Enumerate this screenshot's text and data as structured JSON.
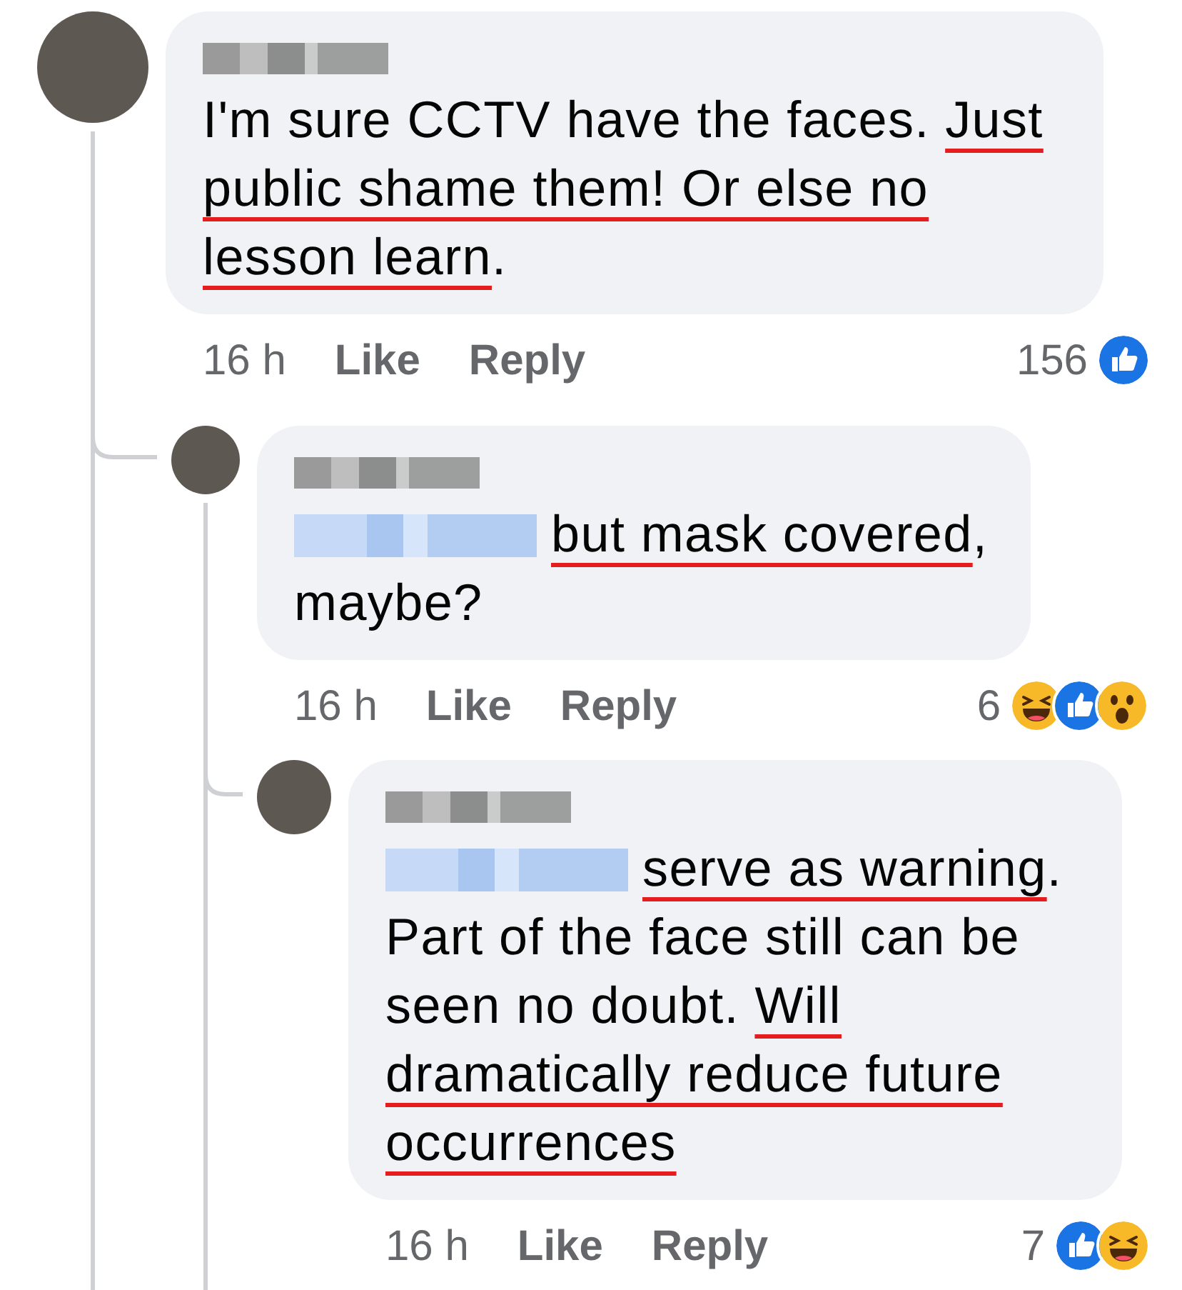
{
  "comments": [
    {
      "text": [
        {
          "kind": "plain",
          "text": "I'm sure CCTV have the faces. "
        },
        {
          "kind": "underlined",
          "text": "Just public shame them! Or else no lesson learn"
        },
        {
          "kind": "plain",
          "text": "."
        }
      ],
      "time": "16 h",
      "like_label": "Like",
      "reply_label": "Reply",
      "reaction_count": "156",
      "reactions": [
        {
          "kind": "like"
        }
      ],
      "children": [
        {
          "text": [
            {
              "kind": "mention"
            },
            {
              "kind": "underlined",
              "text": "but mask covered"
            },
            {
              "kind": "plain",
              "text": ", maybe?"
            }
          ],
          "time": "16 h",
          "like_label": "Like",
          "reply_label": "Reply",
          "reaction_count": "6",
          "reactions": [
            {
              "kind": "haha"
            },
            {
              "kind": "like"
            },
            {
              "kind": "wow"
            }
          ],
          "children": [
            {
              "text": [
                {
                  "kind": "mention"
                },
                {
                  "kind": "underlined",
                  "text": "serve as warning"
                },
                {
                  "kind": "plain",
                  "text": ". Part of the face still can be seen no doubt. "
                },
                {
                  "kind": "underlined",
                  "text": "Will dramatically reduce future occurrences"
                }
              ],
              "time": "16 h",
              "like_label": "Like",
              "reply_label": "Reply",
              "reaction_count": "7",
              "reactions": [
                {
                  "kind": "like"
                },
                {
                  "kind": "haha"
                }
              ]
            }
          ]
        }
      ]
    }
  ]
}
